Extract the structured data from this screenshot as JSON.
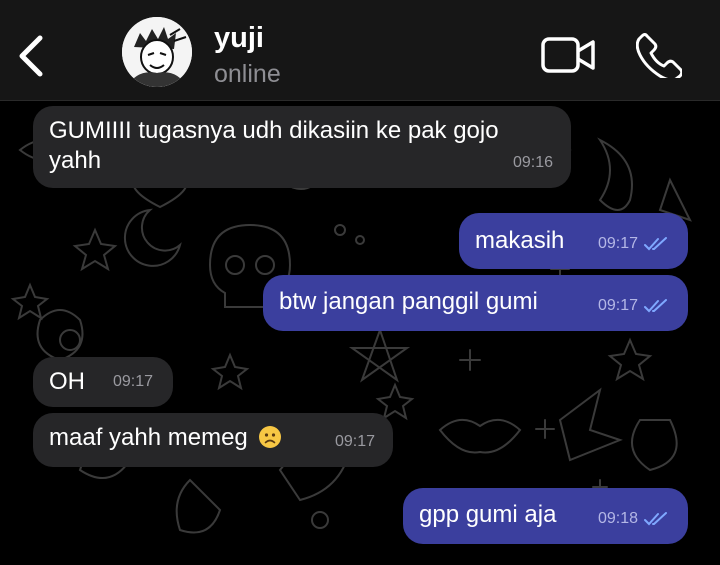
{
  "header": {
    "contact_name": "yuji",
    "status": "online"
  },
  "icons": {
    "back": "chevron-left-icon",
    "video": "video-camera-icon",
    "call": "phone-icon",
    "read_receipt": "double-check-icon",
    "sad_face": "frowning-face-emoji"
  },
  "colors": {
    "incoming_bubble": "#262628",
    "outgoing_bubble": "#3b3f9e",
    "read_tick": "#7fa8ff"
  },
  "messages": [
    {
      "direction": "incoming",
      "text_line1": "GUMIIII tugasnya udh dikasiin ke pak gojo",
      "text_line2": "yahh",
      "time": "09:16"
    },
    {
      "direction": "outgoing",
      "text": "makasih",
      "time": "09:17",
      "read": true
    },
    {
      "direction": "outgoing",
      "text": "btw jangan panggil gumi",
      "time": "09:17",
      "read": true
    },
    {
      "direction": "incoming",
      "text": "OH",
      "time": "09:17"
    },
    {
      "direction": "incoming",
      "text": "maaf yahh memeg",
      "emoji": "☹",
      "time": "09:17"
    },
    {
      "direction": "outgoing",
      "text": "gpp gumi aja",
      "time": "09:18",
      "read": true
    }
  ]
}
